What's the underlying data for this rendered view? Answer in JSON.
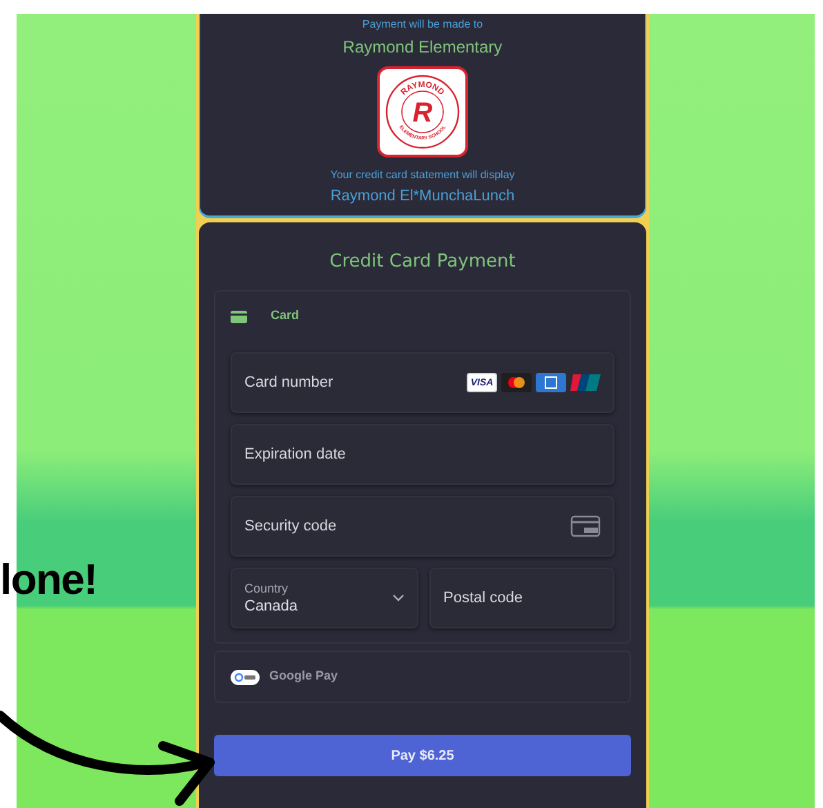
{
  "payee": {
    "caption": "Payment will be made to",
    "name": "Raymond Elementary",
    "logo": {
      "initial": "R",
      "top_text": "RAYMOND",
      "bottom_text": "ELEMENTARY SCHOOL"
    },
    "statement_caption": "Your credit card statement will display",
    "statement_name": "Raymond El*MunchaLunch"
  },
  "form": {
    "title": "Credit Card Payment",
    "card_tab": {
      "label": "Card",
      "selected": true
    },
    "fields": [
      {
        "kind": "card_number",
        "label": "Card number",
        "brands": [
          {
            "kind": "visa",
            "label": "VISA"
          },
          {
            "kind": "mastercard"
          },
          {
            "kind": "amex"
          },
          {
            "kind": "unionpay"
          }
        ]
      },
      {
        "kind": "text",
        "label": "Expiration date"
      },
      {
        "kind": "cvc",
        "label": "Security code"
      }
    ],
    "country": {
      "label": "Country",
      "value": "Canada"
    },
    "postal": {
      "label": "Postal code"
    },
    "google_pay": {
      "label": "Google Pay",
      "selected": false
    },
    "pay_button": "Pay $6.25"
  },
  "overlay_text": "lone!"
}
